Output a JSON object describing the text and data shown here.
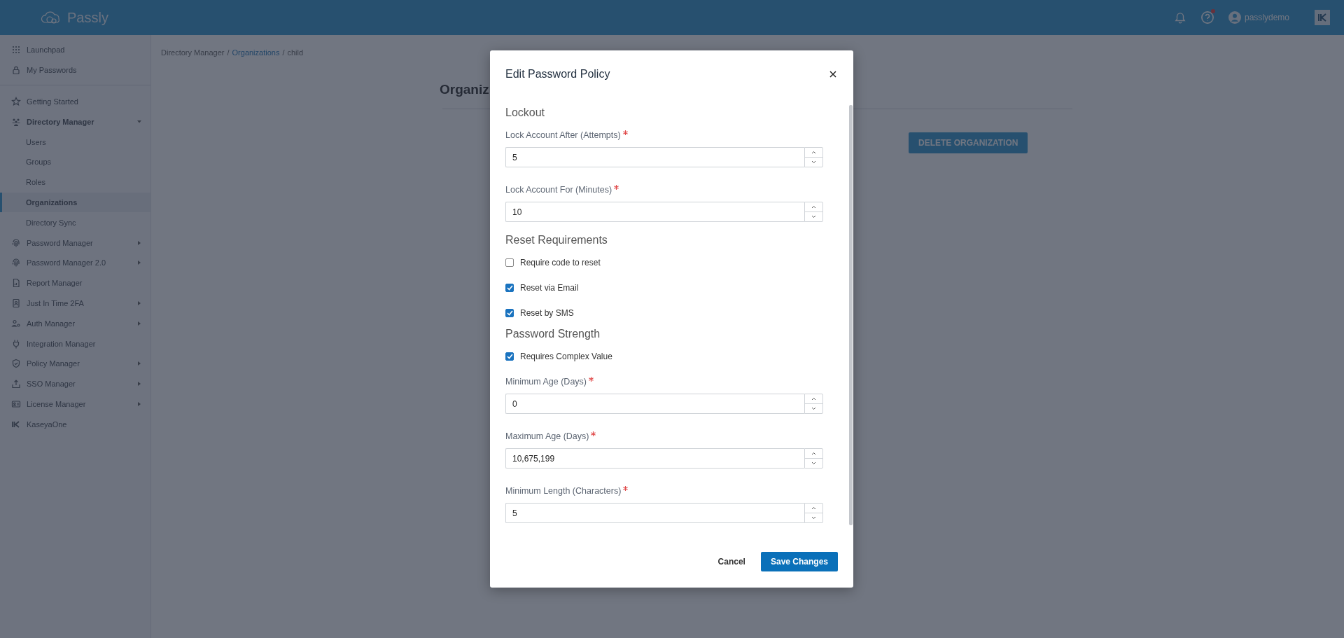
{
  "header": {
    "brand": "Passly",
    "help_alert": true,
    "user": "passlydemo"
  },
  "sidebar": {
    "sections": [
      {
        "items": [
          {
            "kind": "link",
            "label": "Launchpad",
            "selected": false
          },
          {
            "kind": "link",
            "label": "My Passwords",
            "selected": false
          }
        ]
      },
      {
        "items": [
          {
            "kind": "link",
            "label": "Getting Started",
            "selected": false
          },
          {
            "kind": "group",
            "label": "Directory Manager",
            "selected": false,
            "expanded": true,
            "children": [
              {
                "kind": "link",
                "label": "Users",
                "selected": false
              },
              {
                "kind": "link",
                "label": "Groups",
                "selected": false
              },
              {
                "kind": "link",
                "label": "Roles",
                "selected": false
              },
              {
                "kind": "link",
                "label": "Organizations",
                "selected": true
              },
              {
                "kind": "link",
                "label": "Directory Sync",
                "selected": false
              }
            ]
          },
          {
            "kind": "group",
            "label": "Password Manager",
            "selected": false,
            "expanded": false
          },
          {
            "kind": "group",
            "label": "Password Manager 2.0",
            "selected": false,
            "expanded": false
          },
          {
            "kind": "link",
            "label": "Report Manager",
            "selected": false
          },
          {
            "kind": "group",
            "label": "Just In Time 2FA",
            "selected": false,
            "expanded": false
          },
          {
            "kind": "group",
            "label": "Auth Manager",
            "selected": false,
            "expanded": false
          },
          {
            "kind": "link",
            "label": "Integration Manager",
            "selected": false
          },
          {
            "kind": "group",
            "label": "Policy Manager",
            "selected": false,
            "expanded": false
          },
          {
            "kind": "group",
            "label": "SSO Manager",
            "selected": false,
            "expanded": false
          },
          {
            "kind": "group",
            "label": "License Manager",
            "selected": false,
            "expanded": false
          },
          {
            "kind": "link",
            "label": "KaseyaOne",
            "selected": false
          }
        ]
      }
    ]
  },
  "breadcrumb": [
    {
      "kind": "text",
      "label": "Directory Manager"
    },
    {
      "kind": "separator",
      "label": "/"
    },
    {
      "kind": "link",
      "label": "Organizations"
    },
    {
      "kind": "separator",
      "label": "/"
    },
    {
      "kind": "text",
      "label": "child"
    }
  ],
  "page": {
    "title": "Organiz",
    "delete_button": "DELETE ORGANIZATION"
  },
  "dialog": {
    "title": "Edit Password Policy",
    "sections": [
      {
        "heading": "Lockout",
        "items": [
          {
            "kind": "number",
            "label": "Lock Account After (Attempts)",
            "required": true,
            "value": "5"
          },
          {
            "kind": "number",
            "label": "Lock Account For (Minutes)",
            "required": true,
            "value": "10"
          }
        ]
      },
      {
        "heading": "Reset Requirements",
        "items": [
          {
            "kind": "checkbox",
            "label": "Require code to reset",
            "checked": false
          },
          {
            "kind": "checkbox",
            "label": "Reset via Email",
            "checked": true
          },
          {
            "kind": "checkbox",
            "label": "Reset by SMS",
            "checked": true
          }
        ]
      },
      {
        "heading": "Password Strength",
        "items": [
          {
            "kind": "checkbox",
            "label": "Requires Complex Value",
            "checked": true
          },
          {
            "kind": "number",
            "label": "Minimum Age (Days)",
            "required": true,
            "value": "0"
          },
          {
            "kind": "number",
            "label": "Maximum Age (Days)",
            "required": true,
            "value": "10,675,199"
          },
          {
            "kind": "number",
            "label": "Minimum Length (Characters)",
            "required": true,
            "value": "5"
          }
        ]
      }
    ],
    "buttons": [
      {
        "kind": "secondary",
        "label": "Cancel"
      },
      {
        "kind": "primary",
        "label": "Save Changes"
      }
    ]
  }
}
